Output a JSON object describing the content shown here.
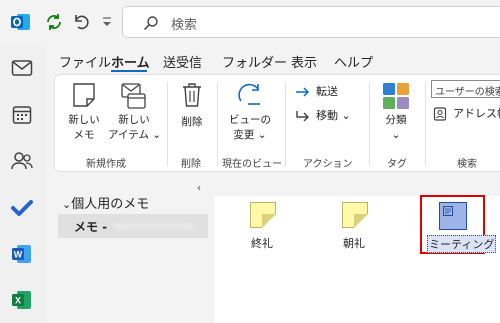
{
  "search": {
    "placeholder": "検索"
  },
  "menu_tabs": [
    "ファイル",
    "ホーム",
    "送受信",
    "フォルダー",
    "表示",
    "ヘルプ"
  ],
  "ribbon": {
    "new_note": [
      "新しい",
      "メモ"
    ],
    "new_item": [
      "新しい",
      "アイテム ⌄"
    ],
    "delete": "削除",
    "change_view": [
      "ビューの",
      "変更 ⌄"
    ],
    "forward": "転送",
    "move": "移動 ⌄",
    "categorize": [
      "分類",
      "⌄"
    ],
    "search_people_placeholder": "ユーザーの検索",
    "address_book": "アドレス帳",
    "groups": {
      "new": "新規作成",
      "delete": "削除",
      "current_view": "現在のビュー",
      "actions": "アクション",
      "tags": "タグ",
      "find": "検索"
    }
  },
  "folder_pane": {
    "group_title": "個人用のメモ",
    "selected_folder": "メモ -"
  },
  "notes": [
    {
      "title": "終礼"
    },
    {
      "title": "朝礼"
    },
    {
      "title": "ミーティング",
      "selected": true
    }
  ],
  "colors": {
    "accent": "#0f6cbd",
    "highlight_box": "#e00000",
    "note_yellow": "#fff9a8",
    "note_selected": "#9fb4e6"
  }
}
